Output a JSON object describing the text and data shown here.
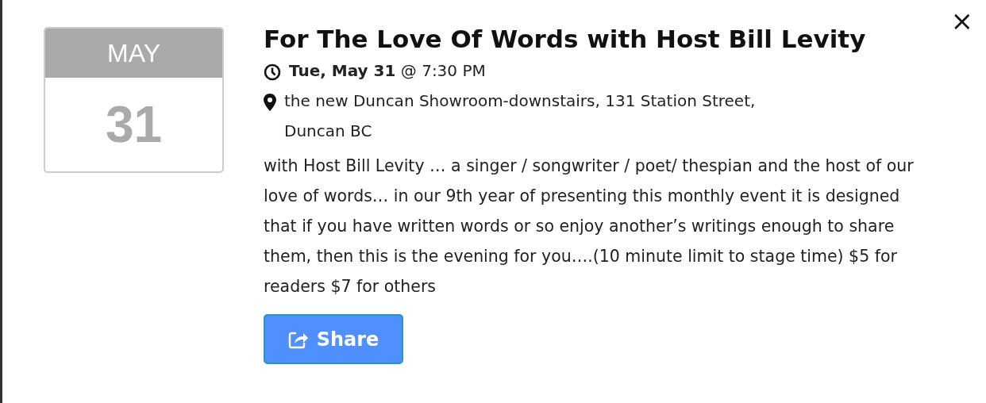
{
  "calendar": {
    "month": "MAY",
    "day": "31"
  },
  "event": {
    "title": "For The Love Of Words with Host Bill Levity",
    "when": "**Tue, May 31** @ 7:30 PM",
    "location": "the new Duncan Showroom-downstairs, 131 Station Street, Duncan BC",
    "description": "with Host Bill Levity … a singer / songwriter / poet/ thespian and the host of our love of words… in our 9th year of presenting this monthly event it is designed that if you have written words or so enjoy another’s writings enough to share them, then this is the evening for you….(10 minute limit to stage time) $5 for readers $7 for others"
  },
  "share_button": {
    "label": "Share"
  },
  "close_button": {
    "label": "×"
  }
}
